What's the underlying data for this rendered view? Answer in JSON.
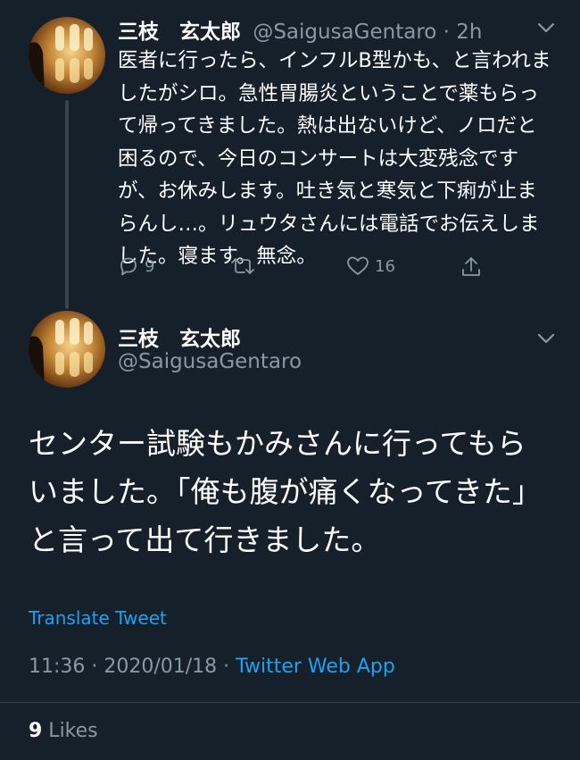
{
  "tweet1": {
    "name": "三枝　玄太郎",
    "handle": "@SaigusaGentaro",
    "time": "· 2h",
    "body": "医者に行ったら、インフルB型かも、と言われましたがシロ。急性胃腸炎ということで薬もらって帰ってきました。熱は出ないけど、ノロだと困るので、今日のコンサートは大変残念ですが、お休みします。吐き気と寒気と下痢が止まらんし…。リュウタさんには電話でお伝えしました。寝ます。無念。",
    "reply_count": "9",
    "retweet_count": "",
    "like_count": "16",
    "icons": [
      "reply-icon",
      "retweet-icon",
      "like-icon",
      "share-icon",
      "chevron-down-icon"
    ]
  },
  "tweet2": {
    "name": "三枝　玄太郎",
    "handle": "@SaigusaGentaro",
    "body": "センター試験もかみさんに行ってもらいました。「俺も腹が痛くなってきた」と言って出て行きました。",
    "translate_label": "Translate Tweet",
    "timestamp": "11:36 · 2020/01/18 · ",
    "source": "Twitter Web App",
    "likes_count": "9",
    "likes_label": " Likes"
  },
  "colors": {
    "background": "#15202b",
    "text_primary": "#ffffff",
    "text_secondary": "#8899a6",
    "accent": "#1da1f2",
    "divider": "#38444d"
  }
}
